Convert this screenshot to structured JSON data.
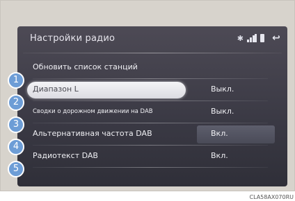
{
  "screen": {
    "title": "Настройки радио"
  },
  "items": [
    {
      "number": "1",
      "label": "Обновить список станций",
      "value": ""
    },
    {
      "number": "2",
      "label": "Диапазон L",
      "value": "Выкл."
    },
    {
      "number": "3",
      "label": "Сводки о дорожном движении на DAB",
      "value": "Выкл."
    },
    {
      "number": "4",
      "label": "Альтернативная частота DAB",
      "value": "Вкл."
    },
    {
      "number": "5",
      "label": "Радиотекст DAB",
      "value": "Вкл."
    }
  ],
  "watermark": "CLA58AX070RU",
  "colors": {
    "badge": "#6d9dd6",
    "screen_bg": "#3a3944"
  }
}
